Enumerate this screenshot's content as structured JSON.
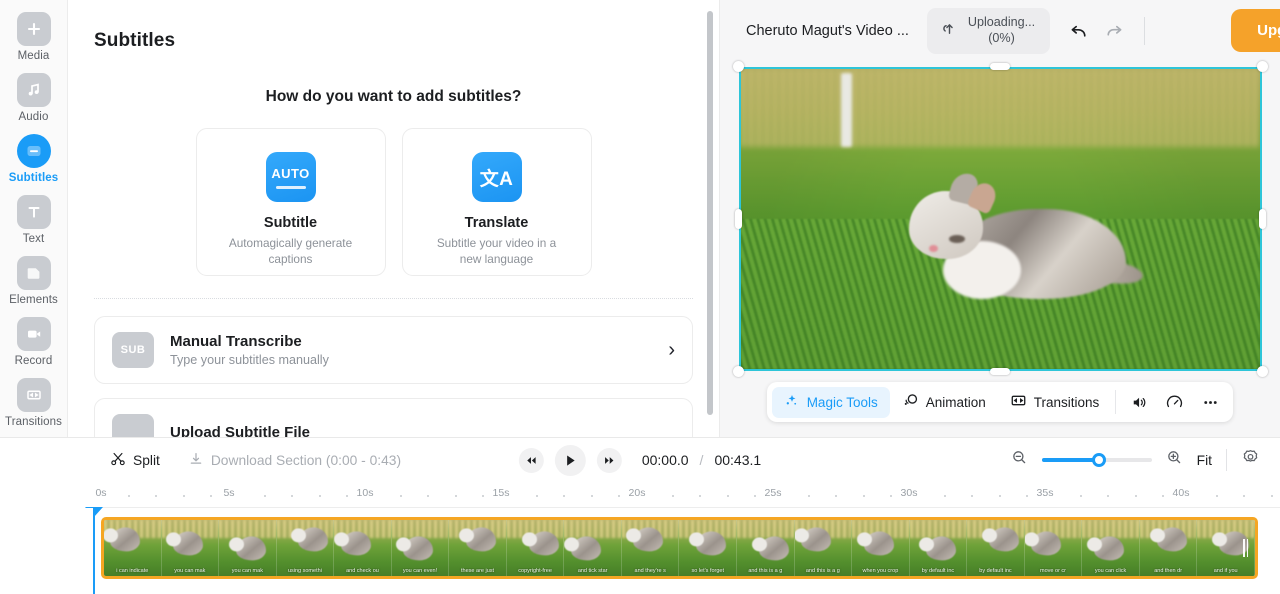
{
  "sidebar": {
    "items": [
      {
        "label": "Media",
        "icon": "plus-icon"
      },
      {
        "label": "Audio",
        "icon": "music-note-icon"
      },
      {
        "label": "Subtitles",
        "icon": "subtitle-icon"
      },
      {
        "label": "Text",
        "icon": "text-t-icon"
      },
      {
        "label": "Elements",
        "icon": "shape-icon"
      },
      {
        "label": "Record",
        "icon": "camera-icon"
      },
      {
        "label": "Transitions",
        "icon": "transitions-icon"
      }
    ],
    "active": "Subtitles",
    "help_label": "?"
  },
  "panel": {
    "title": "Subtitles",
    "question": "How do you want to add subtitles?",
    "cards": [
      {
        "badge": "AUTO",
        "title": "Subtitle",
        "subtitle": "Automagically generate captions"
      },
      {
        "badge": "文A",
        "title": "Translate",
        "subtitle": "Subtitle your video in a new language"
      }
    ],
    "rows": [
      {
        "badge": "SUB",
        "title": "Manual Transcribe",
        "subtitle": "Type your subtitles manually",
        "chevron": "›"
      },
      {
        "badge": "",
        "title": "Upload Subtitle File",
        "subtitle": "",
        "chevron": "›"
      }
    ]
  },
  "header": {
    "video_title": "Cheruto Magut's Video ...",
    "upload_status": "Uploading...",
    "upload_percent": "(0%)",
    "undo_label": "undo",
    "redo_label": "redo",
    "upgrade_label": "Upgrade",
    "collapse_chevron": "⌄"
  },
  "preview_toolbar": {
    "items": [
      {
        "label": "Magic Tools",
        "icon": "sparkles-icon",
        "active": true
      },
      {
        "label": "Animation",
        "icon": "animation-icon",
        "active": false
      },
      {
        "label": "Transitions",
        "icon": "transitions-icon",
        "active": false
      }
    ],
    "icon_buttons": [
      {
        "name": "volume-icon"
      },
      {
        "name": "speed-icon"
      },
      {
        "name": "more-options-icon"
      }
    ]
  },
  "timeline": {
    "split_label": "Split",
    "download_label": "Download Section (0:00 - 0:43)",
    "current_time": "00:00.0",
    "separator": "/",
    "total_time": "00:43.1",
    "fit_label": "Fit",
    "zoom_out_icon": "zoom-out-icon",
    "zoom_in_icon": "zoom-in-icon",
    "settings_icon": "gear-icon",
    "ruler_labels": [
      "0s",
      "5s",
      "10s",
      "15s",
      "20s",
      "25s",
      "30s",
      "35s",
      "40s"
    ],
    "clip_captions": [
      "i can indicate",
      "you can mak",
      "you can mak",
      "using somethi",
      "and check ou",
      "you can even!",
      "these are just",
      "copyright-free",
      "and tick star",
      "and they're s",
      "so let's forget",
      "and this is a g",
      "and this is a g",
      "when you crop",
      "by default inc",
      "by default inc",
      "move or cr",
      "you can click",
      "and then dr",
      "and if you"
    ]
  }
}
